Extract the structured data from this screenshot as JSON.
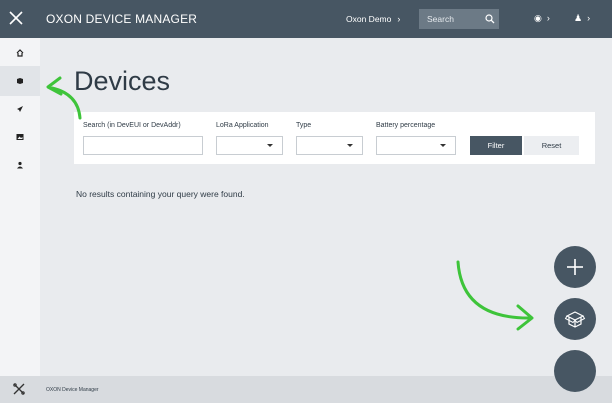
{
  "header": {
    "title": "OXON DEVICE MANAGER",
    "workspace": "Oxon Demo",
    "search_placeholder": "Search"
  },
  "sidebar": {
    "items": [
      {
        "icon": "home-icon"
      },
      {
        "icon": "device-icon",
        "active": true
      },
      {
        "icon": "rocket-icon"
      },
      {
        "icon": "image-icon"
      },
      {
        "icon": "user-icon"
      }
    ]
  },
  "main": {
    "title": "Devices",
    "filters": {
      "search_label": "Search (in DevEUI or DevAddr)",
      "lora_label": "LoRa Application",
      "type_label": "Type",
      "battery_label": "Battery percentage",
      "filter_button": "Filter",
      "reset_button": "Reset"
    },
    "empty_message": "No results containing your query were found."
  },
  "footer": {
    "text": "OXON Device Manager"
  },
  "colors": {
    "topbar": "#475663",
    "accent_arrow": "#3ec43a",
    "fab": "#475663"
  }
}
